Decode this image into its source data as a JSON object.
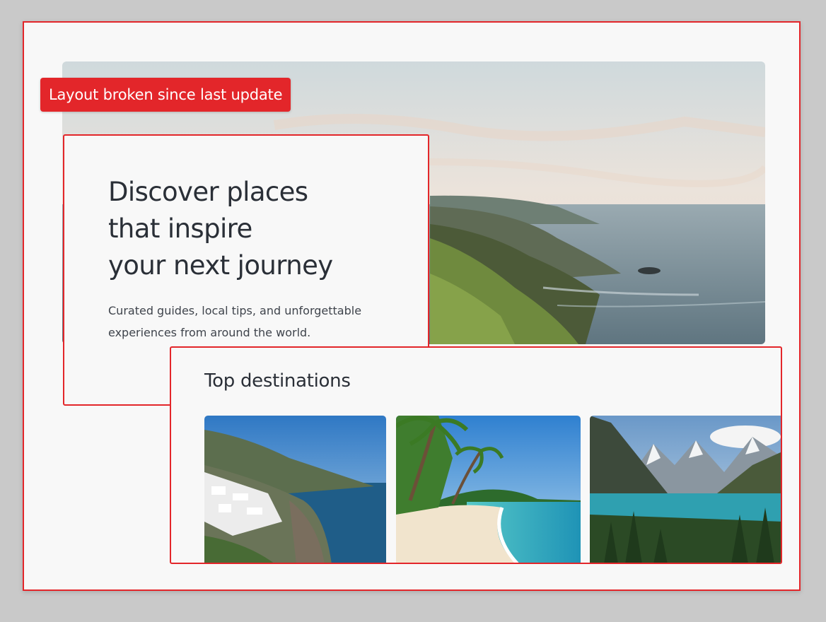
{
  "status_badge": {
    "label": "Layout broken since last update",
    "color": "#e3262a"
  },
  "hero": {
    "title_lines": [
      "Discover places",
      "that inspire",
      "your next journey"
    ],
    "subtitle": "Curated guides, local tips, and unforgettable experiences from around the world.",
    "image": "coastal-cliffs-at-dawn"
  },
  "destinations": {
    "heading": "Top destinations",
    "cards": [
      {
        "image": "whitewashed-cliff-village-by-the-sea"
      },
      {
        "image": "tropical-palm-beach"
      },
      {
        "image": "alpine-lake-with-pine-forest"
      }
    ]
  },
  "colors": {
    "accent": "#e3262a",
    "text": "#2a2f37",
    "page": "#f8f8f8"
  }
}
